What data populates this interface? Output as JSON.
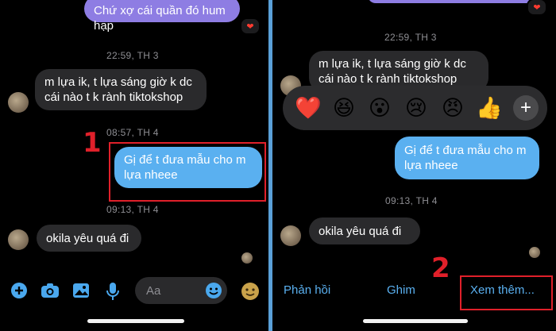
{
  "left": {
    "top_bubble": "Chứ xợ cái quần đó hum hạp",
    "time1": "22:59, TH 3",
    "incoming1": [
      "m lựa ik, t lựa sáng giờ k dc",
      "cái nào t k rành tiktokshop"
    ],
    "time2": "08:57, TH 4",
    "outgoing": [
      "Gị để t đưa mẫu cho m",
      "lựa nheee"
    ],
    "time3": "09:13, TH 4",
    "incoming2": "okila yêu quá đi",
    "input_placeholder": "Aa",
    "step": "1"
  },
  "right": {
    "time1": "22:59, TH 3",
    "incoming1": [
      "m lựa ik, t lựa sáng giờ k dc",
      "cái nào t k rành tiktokshop"
    ],
    "emojis": [
      "❤️",
      "😆",
      "😮",
      "😢",
      "😠",
      "👍"
    ],
    "outgoing": [
      "Gị để t đưa mẫu cho m",
      "lựa nheee"
    ],
    "time2": "09:13, TH 4",
    "incoming2": "okila yêu quá đi",
    "actions": {
      "reply": "Phản hồi",
      "pin": "Ghim",
      "more": "Xem thêm..."
    },
    "step": "2"
  },
  "colors": {
    "outgoing_blue": "#5ab0f0",
    "outgoing_purple": "#8e7de3",
    "incoming_gray": "#2a2a2c",
    "highlight_red": "#e0202a",
    "divider_blue": "#5aa0d8"
  }
}
